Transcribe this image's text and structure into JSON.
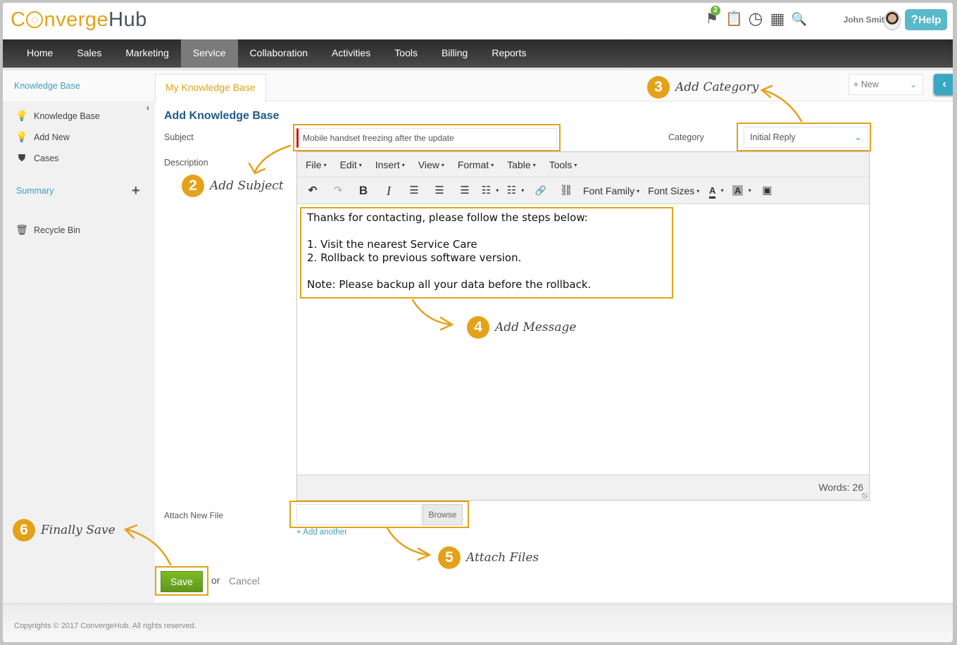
{
  "app": {
    "logo_pre": "C",
    "logo_mid": "nverge",
    "logo_post": "Hub"
  },
  "header": {
    "icons": [
      {
        "name": "flag-icon",
        "glyph": "⚑",
        "badge": "2"
      },
      {
        "name": "tasks-icon",
        "glyph": "📋"
      },
      {
        "name": "clock-icon",
        "glyph": "◷"
      },
      {
        "name": "calendar-icon",
        "glyph": "▦"
      },
      {
        "name": "search-icon",
        "glyph": "🔍"
      }
    ],
    "user_name": "John Smith",
    "help_q": "?",
    "help_label": "Help"
  },
  "nav": {
    "items": [
      "Home",
      "Sales",
      "Marketing",
      "Service",
      "Collaboration",
      "Activities",
      "Tools",
      "Billing",
      "Reports"
    ],
    "active": "Service"
  },
  "sidebar": {
    "title": "Knowledge Base",
    "collapse_glyph": "‹",
    "items": [
      {
        "label": "Knowledge Base",
        "icon": "bulb-icon",
        "glyph": "💡"
      },
      {
        "label": "Add New",
        "icon": "bulb-add-icon",
        "glyph": "💡"
      },
      {
        "label": "Cases",
        "icon": "shield-icon",
        "glyph": "⛊"
      }
    ],
    "summary": "Summary",
    "plus_glyph": "+",
    "recycle": {
      "label": "Recycle Bin",
      "icon": "recycle-bin-icon",
      "glyph": "🗑"
    }
  },
  "tabs": {
    "active_tab": "My Knowledge Base",
    "new_label": "+  New",
    "new_chev": "⌄",
    "toggle_glyph": "‹"
  },
  "form": {
    "title": "Add Knowledge Base",
    "subject_label": "Subject",
    "subject_value": "Mobile handset freezing after the update",
    "category_label": "Category",
    "category_value": "Initial Reply",
    "category_chev": "⌄",
    "description_label": "Description",
    "attach_label": "Attach New File",
    "browse_label": "Browse",
    "add_another": "+ Add another",
    "save_label": "Save",
    "or_text": "or",
    "cancel_label": "Cancel"
  },
  "editor": {
    "menus": [
      "File",
      "Edit",
      "Insert",
      "View",
      "Format",
      "Table",
      "Tools"
    ],
    "caret": "▾",
    "toolbar": {
      "undo": "↶",
      "redo": "↷",
      "bold": "B",
      "italic": "I",
      "align_left": "☰",
      "align_center": "☰",
      "align_right": "☰",
      "bullets": "☷",
      "numbers": "☷",
      "link": "🔗",
      "unlink": "⛓",
      "font_family": "Font Family",
      "font_sizes": "Font Sizes",
      "text_color": "A",
      "bg_color": "A",
      "image": "▣"
    },
    "content": [
      "Thanks for contacting, please follow the steps below:",
      "",
      "1. Visit the nearest Service Care",
      "2. Rollback to previous software version.",
      "",
      "Note: Please backup all your data before the rollback."
    ],
    "word_count_label": "Words: 26"
  },
  "annotations": [
    {
      "num": "2",
      "text": "Add Subject"
    },
    {
      "num": "3",
      "text": "Add Category"
    },
    {
      "num": "4",
      "text": "Add Message"
    },
    {
      "num": "5",
      "text": "Attach Files"
    },
    {
      "num": "6",
      "text": "Finally Save"
    }
  ],
  "footer": {
    "text": "Copyrights © 2017 ConvergeHub. All rights reserved."
  },
  "colors": {
    "accent": "#e3a21a",
    "link": "#3f9fc0",
    "title": "#1f5a8a",
    "save": "#6cab22",
    "nav_active": "#7b7b7b"
  }
}
